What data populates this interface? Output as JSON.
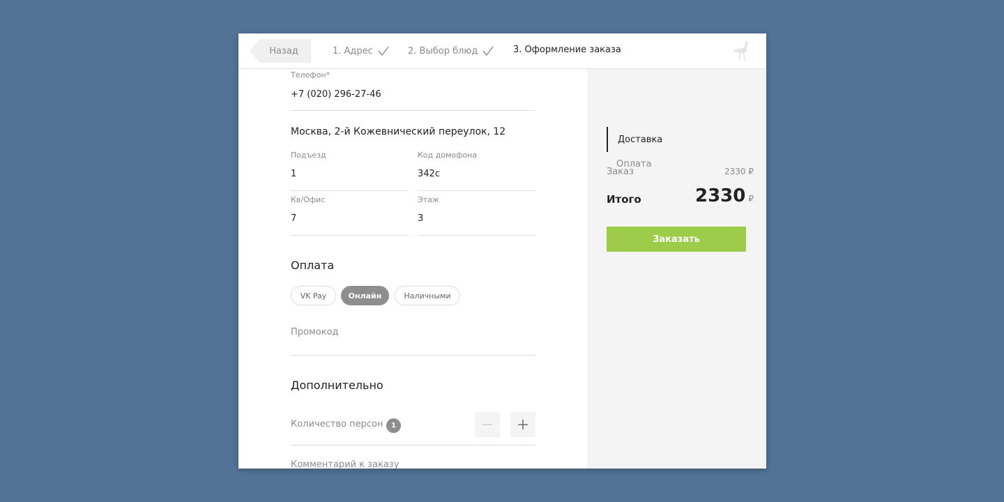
{
  "topbar": {
    "back_label": "Назад",
    "steps": [
      {
        "label": "1. Адрес",
        "done": true
      },
      {
        "label": "2. Выбор блюд",
        "done": true
      },
      {
        "label": "3. Оформление заказа",
        "done": false
      }
    ]
  },
  "form": {
    "phone": {
      "label": "Телефон*",
      "value": "+7 (020) 296-27-46"
    },
    "address": "Москва, 2-й Кожевнический переулок, 12",
    "entrance": {
      "label": "Подъезд",
      "value": "1"
    },
    "door_code": {
      "label": "Код домофона",
      "value": "342с"
    },
    "apartment": {
      "label": "Кв/Офис",
      "value": "7"
    },
    "floor": {
      "label": "Этаж",
      "value": "3"
    }
  },
  "payment": {
    "title": "Оплата",
    "options": [
      "VK Pay",
      "Онлайн",
      "Наличными"
    ],
    "selected": "Онлайн",
    "promo_placeholder": "Промокод"
  },
  "extra": {
    "title": "Дополнительно",
    "persons_label": "Количество персон",
    "persons_count": "1",
    "comment_label": "Комментарий к заказу"
  },
  "sidebar": {
    "nav": [
      "Доставка",
      "Оплата"
    ],
    "order_label": "Заказ",
    "order_amount": "2330 ₽",
    "total_label": "Итого",
    "total_amount": "2330",
    "currency": "₽",
    "order_button": "Заказать"
  },
  "colors": {
    "background": "#527396",
    "accent_green": "#9ccc4a",
    "selected_gray": "#8e8e8e"
  }
}
